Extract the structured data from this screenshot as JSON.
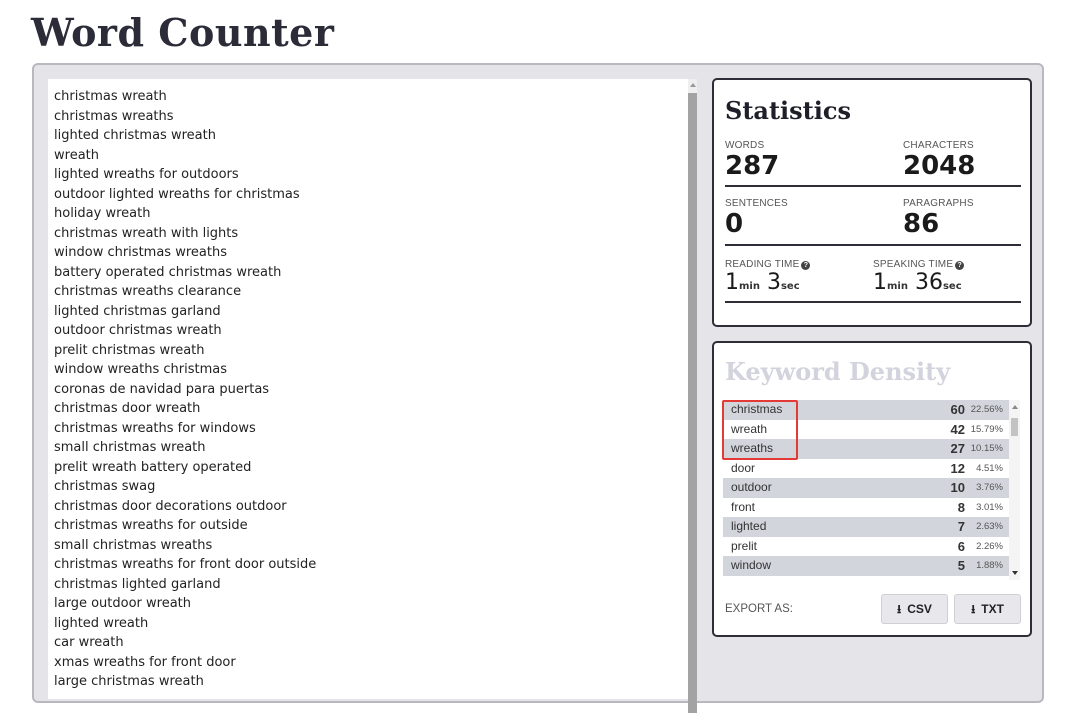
{
  "page_title": "Word Counter",
  "editor": {
    "lines": [
      "christmas wreath",
      "christmas wreaths",
      "lighted christmas wreath",
      "wreath",
      "lighted wreaths for outdoors",
      "outdoor lighted wreaths for christmas",
      "holiday wreath",
      "christmas wreath with lights",
      "window christmas wreaths",
      "battery operated christmas wreath",
      "christmas wreaths clearance",
      "lighted christmas garland",
      "outdoor christmas wreath",
      "prelit christmas wreath",
      "window wreaths christmas",
      "coronas de navidad para puertas",
      "christmas door wreath",
      "christmas wreaths for windows",
      "small christmas wreath",
      "prelit wreath battery operated",
      "christmas swag",
      "christmas door decorations outdoor",
      "christmas wreaths for outside",
      "small christmas wreaths",
      "christmas wreaths for front door outside",
      "christmas lighted garland",
      "large outdoor wreath",
      "lighted wreath",
      "car wreath",
      "xmas wreaths for front door",
      "large christmas wreath"
    ]
  },
  "statistics": {
    "title": "Statistics",
    "words_label": "WORDS",
    "words": "287",
    "characters_label": "CHARACTERS",
    "characters": "2048",
    "sentences_label": "SENTENCES",
    "sentences": "0",
    "paragraphs_label": "PARAGRAPHS",
    "paragraphs": "86",
    "reading_time_label": "READING TIME",
    "reading_min": "1",
    "reading_sec": "3",
    "speaking_time_label": "SPEAKING TIME",
    "speaking_min": "1",
    "speaking_sec": "36",
    "min_unit": "min",
    "sec_unit": "sec",
    "help_glyph": "?"
  },
  "keyword_density": {
    "title": "Keyword Density",
    "rows": [
      {
        "word": "christmas",
        "count": "60",
        "pct": "22.56%"
      },
      {
        "word": "wreath",
        "count": "42",
        "pct": "15.79%"
      },
      {
        "word": "wreaths",
        "count": "27",
        "pct": "10.15%"
      },
      {
        "word": "door",
        "count": "12",
        "pct": "4.51%"
      },
      {
        "word": "outdoor",
        "count": "10",
        "pct": "3.76%"
      },
      {
        "word": "front",
        "count": "8",
        "pct": "3.01%"
      },
      {
        "word": "lighted",
        "count": "7",
        "pct": "2.63%"
      },
      {
        "word": "prelit",
        "count": "6",
        "pct": "2.26%"
      },
      {
        "word": "window",
        "count": "5",
        "pct": "1.88%"
      }
    ],
    "highlight_color": "#e53935"
  },
  "export": {
    "label": "EXPORT AS:",
    "csv_label": "CSV",
    "txt_label": "TXT",
    "icon_glyph": "⭳"
  },
  "icons": [
    "help-icon",
    "download-icon"
  ]
}
